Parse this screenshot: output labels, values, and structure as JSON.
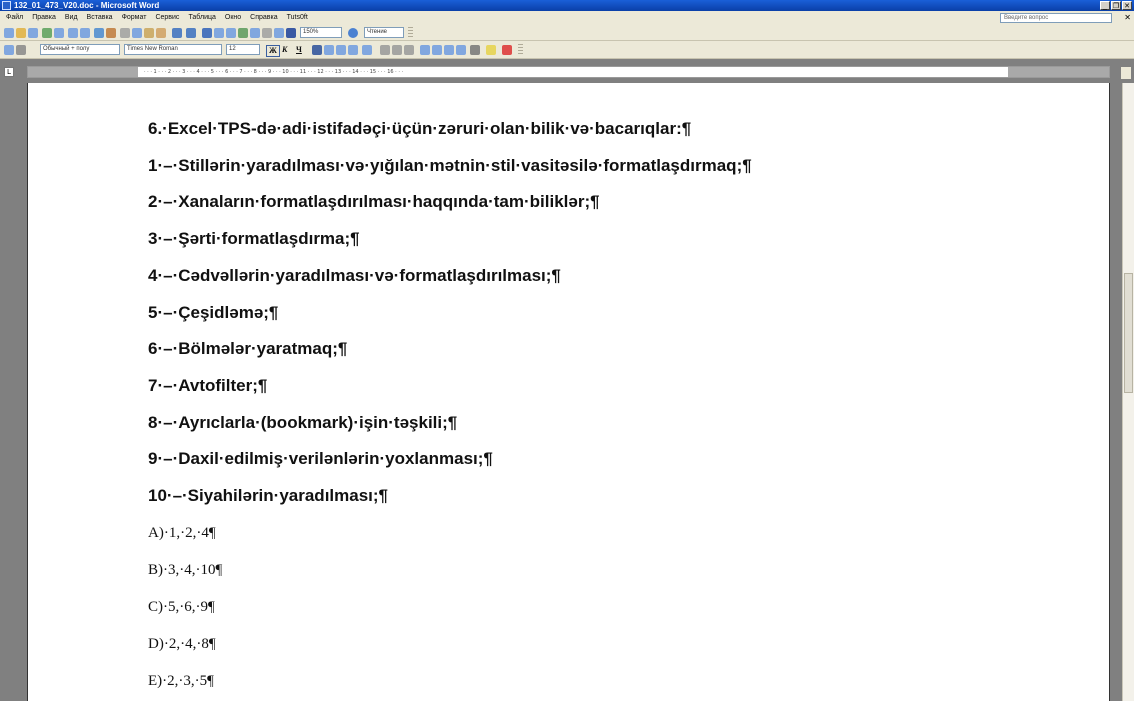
{
  "window": {
    "title": "132_01_473_V20.doc - Microsoft Word",
    "controls": [
      "_",
      "❐",
      "✕"
    ]
  },
  "menubar": {
    "items": [
      "Файл",
      "Правка",
      "Вид",
      "Вставка",
      "Формат",
      "Сервис",
      "Таблица",
      "Окно",
      "Справка",
      "Tuts0ft"
    ],
    "ask_placeholder": "Введите вопрос",
    "doc_close": "✕"
  },
  "toolbar": {
    "zoom": "150%",
    "read_label": "Чтение",
    "style": "Обычный + полу",
    "font": "Times New Roman",
    "size": "12",
    "bold": "Ж",
    "italic": "К",
    "underline": "Ч"
  },
  "ruler": {
    "ticks": "· · · 1 · · · 2 · · · 3 · · · 4 · · · 5 · · · 6 · · · 7 · · · 8 · · · 9 · · · 10 · · · 11 · · · 12 · · · 13 · · · 14 · · · 15 · · · 16 · · ·",
    "tab_marker": "L"
  },
  "document": {
    "lines": [
      "6.·Excel·TPS-də·adi·istifadəçi·üçün·zəruri·olan·bilik·və·bacarıqlar:¶",
      "1·–·Stillərin·yaradılması·və·yığılan·mətnin·stil·vasitəsilə·formatlaşdırmaq;¶",
      "2·–·Xanaların·formatlaşdırılması·haqqında·tam·biliklər;¶",
      "3·–·Şərti·formatlaşdırma;¶",
      "4·–·Cədvəllərin·yaradılması·və·formatlaşdırılması;¶",
      "5·–·Çeşidləmə;¶",
      "6·–·Bölmələr·yaratmaq;¶",
      "7·–·Avtofilter;¶",
      "8·–·Ayrıclarla·(bookmark)·işin·təşkili;¶",
      "9·–·Daxil·edilmiş·verilənlərin·yoxlanması;¶",
      "10·–·Siyahilərin·yaradılması;¶"
    ],
    "options": [
      "A)·1,·2,·4¶",
      "B)·3,·4,·10¶",
      "C)·5,·6,·9¶",
      "D)·2,·4,·8¶",
      "E)·2,·3,·5¶"
    ]
  }
}
